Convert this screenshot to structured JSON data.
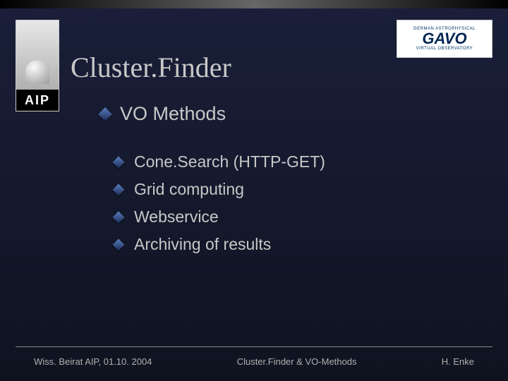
{
  "logos": {
    "left_text": "AIP",
    "right_top": "GERMAN ASTROPHYSICAL",
    "right_mid": "GAVO",
    "right_bot": "VIRTUAL OBSERVATORY"
  },
  "title": "Cluster.Finder",
  "section_heading": "VO Methods",
  "items": [
    "Cone.Search (HTTP-GET)",
    "Grid computing",
    "Webservice",
    "Archiving of results"
  ],
  "footer": {
    "left": "Wiss. Beirat AIP, 01.10. 2004",
    "center": "Cluster.Finder & VO-Methods",
    "right": "H. Enke"
  }
}
